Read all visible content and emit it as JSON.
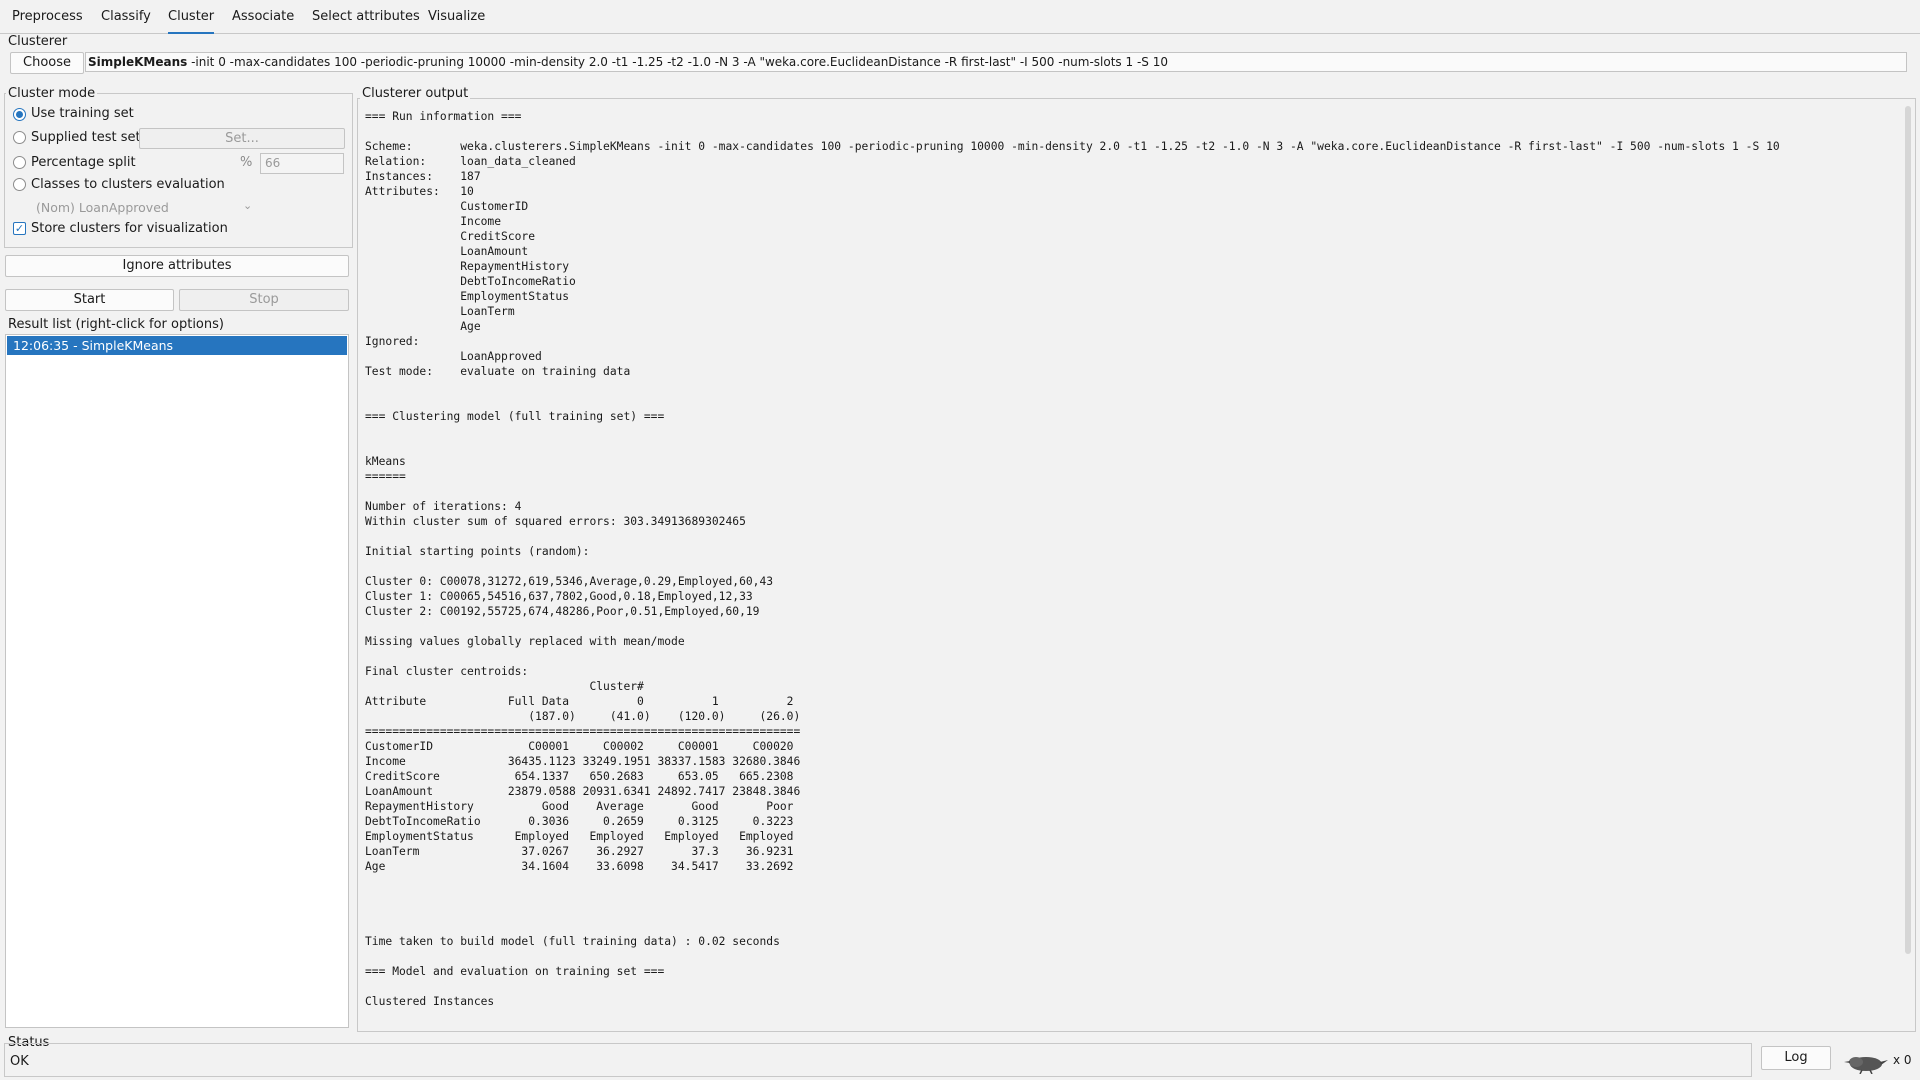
{
  "tabs": [
    "Preprocess",
    "Classify",
    "Cluster",
    "Associate",
    "Select attributes",
    "Visualize"
  ],
  "clusterer": {
    "title": "Clusterer",
    "choose_label": "Choose",
    "scheme_name": "SimpleKMeans",
    "scheme_args": " -init 0 -max-candidates 100 -periodic-pruning 10000 -min-density 2.0 -t1 -1.25 -t2 -1.0 -N 3 -A \"weka.core.EuclideanDistance -R first-last\" -I 500 -num-slots 1 -S 10"
  },
  "cluster_mode": {
    "title": "Cluster mode",
    "use_training_set": "Use training set",
    "supplied_test_set": "Supplied test set",
    "set_button": "Set...",
    "percentage_split": "Percentage split",
    "percent_symbol": "%",
    "percent_value": "66",
    "classes_to_clusters": "Classes to clusters evaluation",
    "class_attribute": "(Nom) LoanApproved",
    "store_clusters": "Store clusters for visualization"
  },
  "ignore_attributes_label": "Ignore attributes",
  "start_label": "Start",
  "stop_label": "Stop",
  "result_list": {
    "title": "Result list (right-click for options)",
    "items": [
      "12:06:35 - SimpleKMeans"
    ]
  },
  "output": {
    "title": "Clusterer output",
    "lines": [
      "=== Run information ===",
      "",
      "Scheme:       weka.clusterers.SimpleKMeans -init 0 -max-candidates 100 -periodic-pruning 10000 -min-density 2.0 -t1 -1.25 -t2 -1.0 -N 3 -A \"weka.core.EuclideanDistance -R first-last\" -I 500 -num-slots 1 -S 10",
      "Relation:     loan_data_cleaned",
      "Instances:    187",
      "Attributes:   10",
      "              CustomerID",
      "              Income",
      "              CreditScore",
      "              LoanAmount",
      "              RepaymentHistory",
      "              DebtToIncomeRatio",
      "              EmploymentStatus",
      "              LoanTerm",
      "              Age",
      "Ignored:",
      "              LoanApproved",
      "Test mode:    evaluate on training data",
      "",
      "",
      "=== Clustering model (full training set) ===",
      "",
      "",
      "kMeans",
      "======",
      "",
      "Number of iterations: 4",
      "Within cluster sum of squared errors: 303.34913689302465",
      "",
      "Initial starting points (random):",
      "",
      "Cluster 0: C00078,31272,619,5346,Average,0.29,Employed,60,43",
      "Cluster 1: C00065,54516,637,7802,Good,0.18,Employed,12,33",
      "Cluster 2: C00192,55725,674,48286,Poor,0.51,Employed,60,19",
      "",
      "Missing values globally replaced with mean/mode",
      "",
      "Final cluster centroids:",
      "                                 Cluster#",
      "Attribute            Full Data          0          1          2",
      "                        (187.0)     (41.0)    (120.0)     (26.0)",
      "================================================================",
      "CustomerID              C00001     C00002     C00001     C00020",
      "Income               36435.1123 33249.1951 38337.1583 32680.3846",
      "CreditScore           654.1337   650.2683     653.05   665.2308",
      "LoanAmount           23879.0588 20931.6341 24892.7417 23848.3846",
      "RepaymentHistory          Good    Average       Good       Poor",
      "DebtToIncomeRatio       0.3036     0.2659     0.3125     0.3223",
      "EmploymentStatus      Employed   Employed   Employed   Employed",
      "LoanTerm               37.0267    36.2927       37.3    36.9231",
      "Age                    34.1604    33.6098    34.5417    33.2692",
      "",
      "",
      "",
      "",
      "Time taken to build model (full training data) : 0.02 seconds",
      "",
      "=== Model and evaluation on training set ===",
      "",
      "Clustered Instances"
    ]
  },
  "status": {
    "title": "Status",
    "text": "OK",
    "log_label": "Log",
    "count": "x 0"
  }
}
